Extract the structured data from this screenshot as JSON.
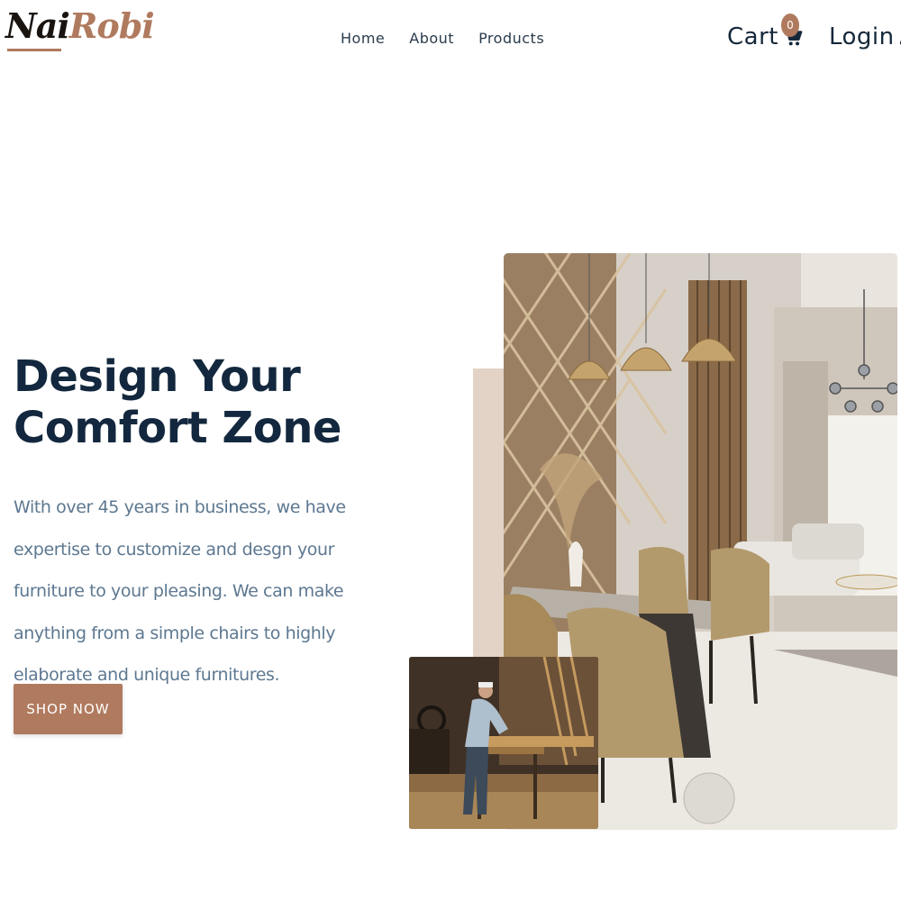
{
  "brand": {
    "logo_part1": "Nai",
    "logo_part2": "Robi"
  },
  "nav": {
    "links": [
      "Home",
      "About",
      "Products"
    ],
    "cart_label": "Cart",
    "cart_count": "0",
    "login_label": "Login",
    "icons": {
      "cart": "shopping-cart-icon",
      "login": "user-plus-icon"
    }
  },
  "hero": {
    "title_line1": "Design Your",
    "title_line2": "Comfort Zone",
    "description": "With over 45 years in business, we have expertise to customize and desgn your furniture to your pleasing. We can make anything from a simple chairs to highly elaborate and unique furnitures.",
    "cta_label": "SHOP NOW",
    "images": [
      "dining-room-photo",
      "carpenter-workshop-photo"
    ]
  },
  "colors": {
    "brand_accent": "#b07a5e",
    "heading": "#13283e",
    "body_text": "#5d7891",
    "accent_block": "#e3d2c6"
  }
}
